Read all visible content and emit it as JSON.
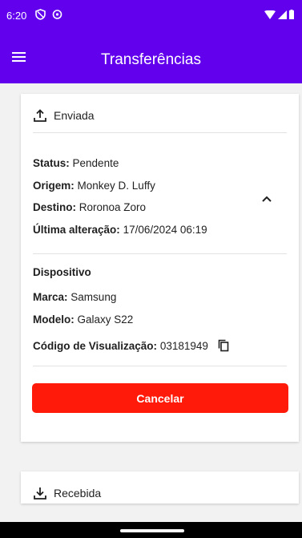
{
  "status_bar": {
    "time": "6:20"
  },
  "app_bar": {
    "title": "Transferências"
  },
  "sent_card": {
    "header": "Enviada",
    "status_label": "Status:",
    "status_value": "Pendente",
    "origin_label": "Origem:",
    "origin_value": "Monkey D. Luffy",
    "dest_label": "Destino:",
    "dest_value": "Roronoa Zoro",
    "last_change_label": "Última alteração:",
    "last_change_value": "17/06/2024 06:19",
    "device_heading": "Dispositivo",
    "brand_label": "Marca:",
    "brand_value": "Samsung",
    "model_label": "Modelo:",
    "model_value": "Galaxy S22",
    "view_code_label": "Código de Visualização:",
    "view_code_value": "03181949",
    "cancel_label": "Cancelar"
  },
  "received_card": {
    "header": "Recebida"
  },
  "colors": {
    "primary": "#6200ee",
    "danger": "#ff1a0a"
  },
  "icons": [
    "menu-icon",
    "upload-icon",
    "chevron-up-icon",
    "copy-icon",
    "download-icon"
  ]
}
